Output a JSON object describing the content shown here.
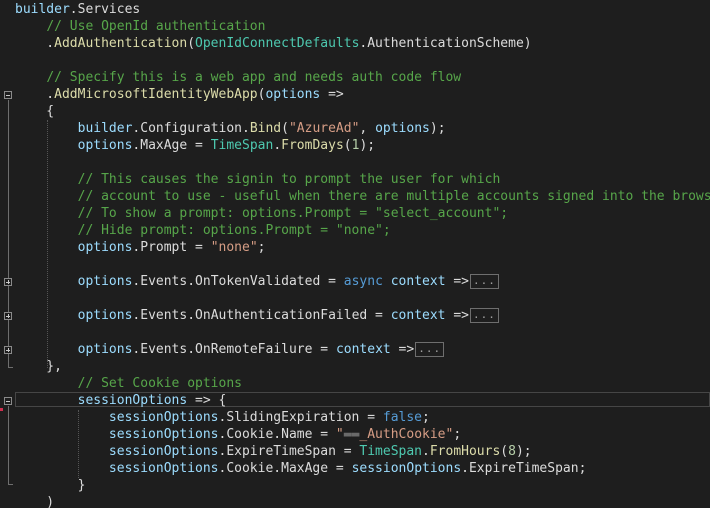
{
  "editor": {
    "lines": [
      {
        "tokens": [
          [
            "ident",
            "builder"
          ],
          [
            "punc",
            "."
          ],
          [
            "member",
            "Services"
          ]
        ]
      },
      {
        "tokens": [
          [
            "punc",
            "    "
          ],
          [
            "cmt",
            "// Use OpenId authentication"
          ]
        ]
      },
      {
        "tokens": [
          [
            "punc",
            "    ."
          ],
          [
            "method",
            "AddAuthentication"
          ],
          [
            "punc",
            "("
          ],
          [
            "type",
            "OpenIdConnectDefaults"
          ],
          [
            "punc",
            "."
          ],
          [
            "member",
            "AuthenticationScheme"
          ],
          [
            "punc",
            ")"
          ]
        ]
      },
      {
        "tokens": []
      },
      {
        "tokens": [
          [
            "punc",
            "    "
          ],
          [
            "cmt",
            "// Specify this is a web app and needs auth code flow"
          ]
        ]
      },
      {
        "tokens": [
          [
            "punc",
            "    ."
          ],
          [
            "method",
            "AddMicrosoftIdentityWebApp"
          ],
          [
            "punc",
            "("
          ],
          [
            "ident",
            "options"
          ],
          [
            "punc",
            " =>"
          ]
        ]
      },
      {
        "tokens": [
          [
            "punc",
            "    {"
          ]
        ]
      },
      {
        "tokens": [
          [
            "punc",
            "        "
          ],
          [
            "ident",
            "builder"
          ],
          [
            "punc",
            "."
          ],
          [
            "member",
            "Configuration"
          ],
          [
            "punc",
            "."
          ],
          [
            "method",
            "Bind"
          ],
          [
            "punc",
            "("
          ],
          [
            "str",
            "\"AzureAd\""
          ],
          [
            "punc",
            ", "
          ],
          [
            "ident",
            "options"
          ],
          [
            "punc",
            ");"
          ]
        ]
      },
      {
        "tokens": [
          [
            "punc",
            "        "
          ],
          [
            "ident",
            "options"
          ],
          [
            "punc",
            "."
          ],
          [
            "member",
            "MaxAge"
          ],
          [
            "punc",
            " = "
          ],
          [
            "type",
            "TimeSpan"
          ],
          [
            "punc",
            "."
          ],
          [
            "method",
            "FromDays"
          ],
          [
            "punc",
            "("
          ],
          [
            "num",
            "1"
          ],
          [
            "punc",
            ");"
          ]
        ]
      },
      {
        "tokens": []
      },
      {
        "tokens": [
          [
            "punc",
            "        "
          ],
          [
            "cmt",
            "// This causes the signin to prompt the user for which"
          ]
        ]
      },
      {
        "tokens": [
          [
            "punc",
            "        "
          ],
          [
            "cmt",
            "// account to use - useful when there are multiple accounts signed into the browser"
          ]
        ]
      },
      {
        "tokens": [
          [
            "punc",
            "        "
          ],
          [
            "cmt",
            "// To show a prompt: options.Prompt = \"select_account\";"
          ]
        ]
      },
      {
        "tokens": [
          [
            "punc",
            "        "
          ],
          [
            "cmt",
            "// Hide prompt: options.Prompt = \"none\";"
          ]
        ]
      },
      {
        "tokens": [
          [
            "punc",
            "        "
          ],
          [
            "ident",
            "options"
          ],
          [
            "punc",
            "."
          ],
          [
            "member",
            "Prompt"
          ],
          [
            "punc",
            " = "
          ],
          [
            "str",
            "\"none\""
          ],
          [
            "punc",
            ";"
          ]
        ]
      },
      {
        "tokens": []
      },
      {
        "tokens": [
          [
            "punc",
            "        "
          ],
          [
            "ident",
            "options"
          ],
          [
            "punc",
            "."
          ],
          [
            "member",
            "Events"
          ],
          [
            "punc",
            "."
          ],
          [
            "member",
            "OnTokenValidated"
          ],
          [
            "punc",
            " = "
          ],
          [
            "kw",
            "async"
          ],
          [
            "punc",
            " "
          ],
          [
            "ident",
            "context"
          ],
          [
            "punc",
            " =>"
          ]
        ],
        "collapsed": "..."
      },
      {
        "tokens": []
      },
      {
        "tokens": [
          [
            "punc",
            "        "
          ],
          [
            "ident",
            "options"
          ],
          [
            "punc",
            "."
          ],
          [
            "member",
            "Events"
          ],
          [
            "punc",
            "."
          ],
          [
            "member",
            "OnAuthenticationFailed"
          ],
          [
            "punc",
            " = "
          ],
          [
            "ident",
            "context"
          ],
          [
            "punc",
            " =>"
          ]
        ],
        "collapsed": "..."
      },
      {
        "tokens": []
      },
      {
        "tokens": [
          [
            "punc",
            "        "
          ],
          [
            "ident",
            "options"
          ],
          [
            "punc",
            "."
          ],
          [
            "member",
            "Events"
          ],
          [
            "punc",
            "."
          ],
          [
            "member",
            "OnRemoteFailure"
          ],
          [
            "punc",
            " = "
          ],
          [
            "ident",
            "context"
          ],
          [
            "punc",
            " =>"
          ]
        ],
        "collapsed": "..."
      },
      {
        "tokens": [
          [
            "punc",
            "    },"
          ]
        ]
      },
      {
        "tokens": [
          [
            "punc",
            "        "
          ],
          [
            "cmt",
            "// Set Cookie options"
          ]
        ]
      },
      {
        "tokens": [
          [
            "punc",
            "        "
          ],
          [
            "ident",
            "sessionOptions"
          ],
          [
            "punc",
            " => {"
          ]
        ]
      },
      {
        "tokens": [
          [
            "punc",
            "            "
          ],
          [
            "ident",
            "sessionOptions"
          ],
          [
            "punc",
            "."
          ],
          [
            "member",
            "SlidingExpiration"
          ],
          [
            "punc",
            " = "
          ],
          [
            "kw",
            "false"
          ],
          [
            "punc",
            ";"
          ]
        ]
      },
      {
        "tokens": [
          [
            "punc",
            "            "
          ],
          [
            "ident",
            "sessionOptions"
          ],
          [
            "punc",
            "."
          ],
          [
            "member",
            "Cookie"
          ],
          [
            "punc",
            "."
          ],
          [
            "member",
            "Name"
          ],
          [
            "punc",
            " = "
          ],
          [
            "str",
            "\""
          ],
          [
            "redact",
            "▬▬"
          ],
          [
            "str",
            "_AuthCookie\""
          ],
          [
            "punc",
            ";"
          ]
        ]
      },
      {
        "tokens": [
          [
            "punc",
            "            "
          ],
          [
            "ident",
            "sessionOptions"
          ],
          [
            "punc",
            "."
          ],
          [
            "member",
            "ExpireTimeSpan"
          ],
          [
            "punc",
            " = "
          ],
          [
            "type",
            "TimeSpan"
          ],
          [
            "punc",
            "."
          ],
          [
            "method",
            "FromHours"
          ],
          [
            "punc",
            "("
          ],
          [
            "num",
            "8"
          ],
          [
            "punc",
            ");"
          ]
        ]
      },
      {
        "tokens": [
          [
            "punc",
            "            "
          ],
          [
            "ident",
            "sessionOptions"
          ],
          [
            "punc",
            "."
          ],
          [
            "member",
            "Cookie"
          ],
          [
            "punc",
            "."
          ],
          [
            "member",
            "MaxAge"
          ],
          [
            "punc",
            " = "
          ],
          [
            "ident",
            "sessionOptions"
          ],
          [
            "punc",
            "."
          ],
          [
            "member",
            "ExpireTimeSpan"
          ],
          [
            "punc",
            ";"
          ]
        ]
      },
      {
        "tokens": [
          [
            "punc",
            "        }"
          ]
        ]
      },
      {
        "tokens": [
          [
            "punc",
            "    )"
          ]
        ]
      }
    ]
  },
  "colors": {
    "background": "#1e1e1e",
    "identifier": "#9cdcfe",
    "method": "#dcdcaa",
    "type": "#4ec9b0",
    "keyword": "#569cd6",
    "string": "#d69d85",
    "number": "#b5cea8",
    "comment": "#57a64a",
    "plain": "#dcdcdc"
  }
}
